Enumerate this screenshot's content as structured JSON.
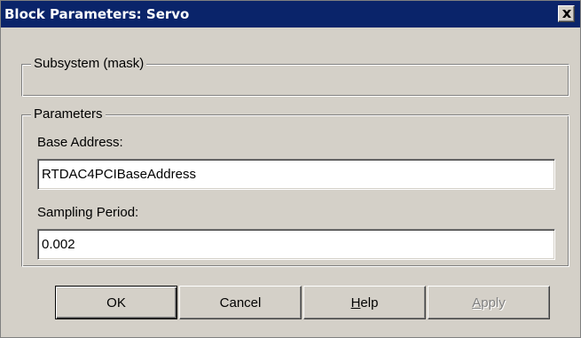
{
  "window": {
    "title": "Block Parameters: Servo",
    "close_icon": "close-icon"
  },
  "subsystem_group": {
    "legend": "Subsystem (mask)"
  },
  "parameters_group": {
    "legend": "Parameters",
    "base_address_label": "Base Address:",
    "base_address_value": "RTDAC4PCIBaseAddress",
    "sampling_period_label": "Sampling Period:",
    "sampling_period_value": "0.002"
  },
  "buttons": {
    "ok": "OK",
    "cancel": "Cancel",
    "help_mnemonic": "H",
    "help_rest": "elp",
    "apply_mnemonic": "A",
    "apply_rest": "pply"
  },
  "colors": {
    "titlebar": "#0a246a",
    "face": "#d4d0c8"
  }
}
